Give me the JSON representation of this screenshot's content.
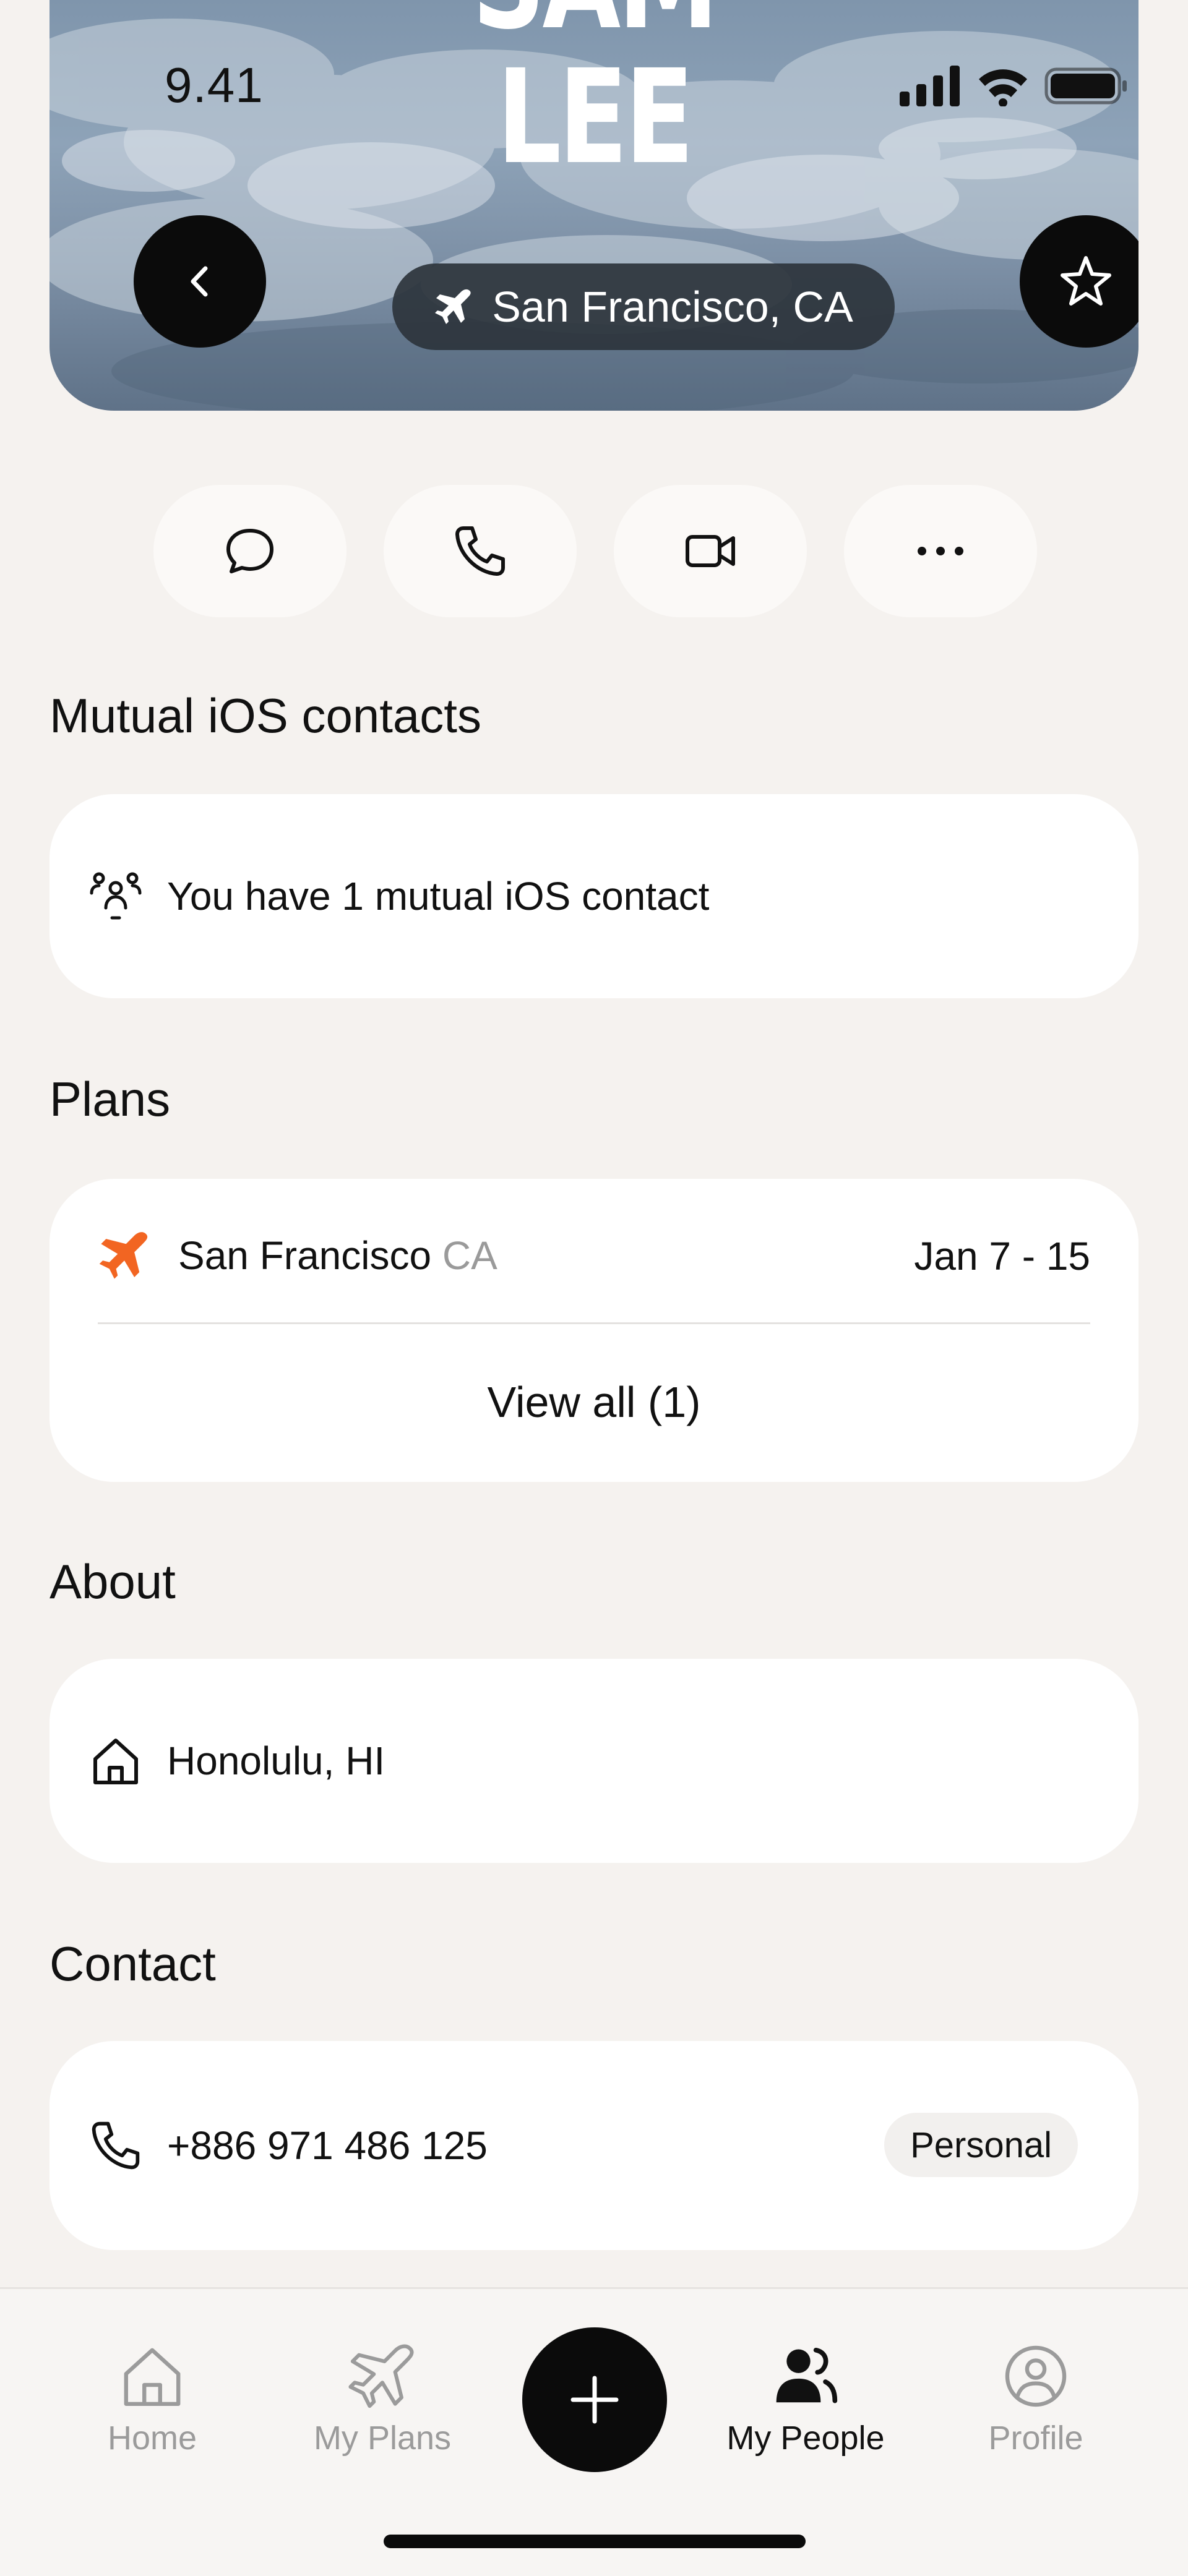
{
  "status_bar": {
    "time": "9.41"
  },
  "hero": {
    "name_line1": "SAM",
    "name_line2": "LEE",
    "location": "San Francisco, CA"
  },
  "actions": [
    "message",
    "call",
    "video",
    "more"
  ],
  "mutual": {
    "title": "Mutual iOS contacts",
    "text": "You have 1 mutual iOS contact"
  },
  "plans": {
    "title": "Plans",
    "items": [
      {
        "city": "San Francisco",
        "state": "CA",
        "dates": "Jan 7 - 15"
      }
    ],
    "view_all": "View all (1)",
    "accent": "#F26522"
  },
  "about": {
    "title": "About",
    "home": "Honolulu, HI"
  },
  "contact": {
    "title": "Contact",
    "phone": "+886 971 486 125",
    "label": "Personal"
  },
  "tabbar": {
    "tabs": [
      {
        "label": "Home",
        "icon": "home-icon"
      },
      {
        "label": "My Plans",
        "icon": "plane-icon"
      },
      {
        "label": "My People",
        "icon": "people-icon",
        "active": true
      },
      {
        "label": "Profile",
        "icon": "profile-icon"
      }
    ]
  }
}
